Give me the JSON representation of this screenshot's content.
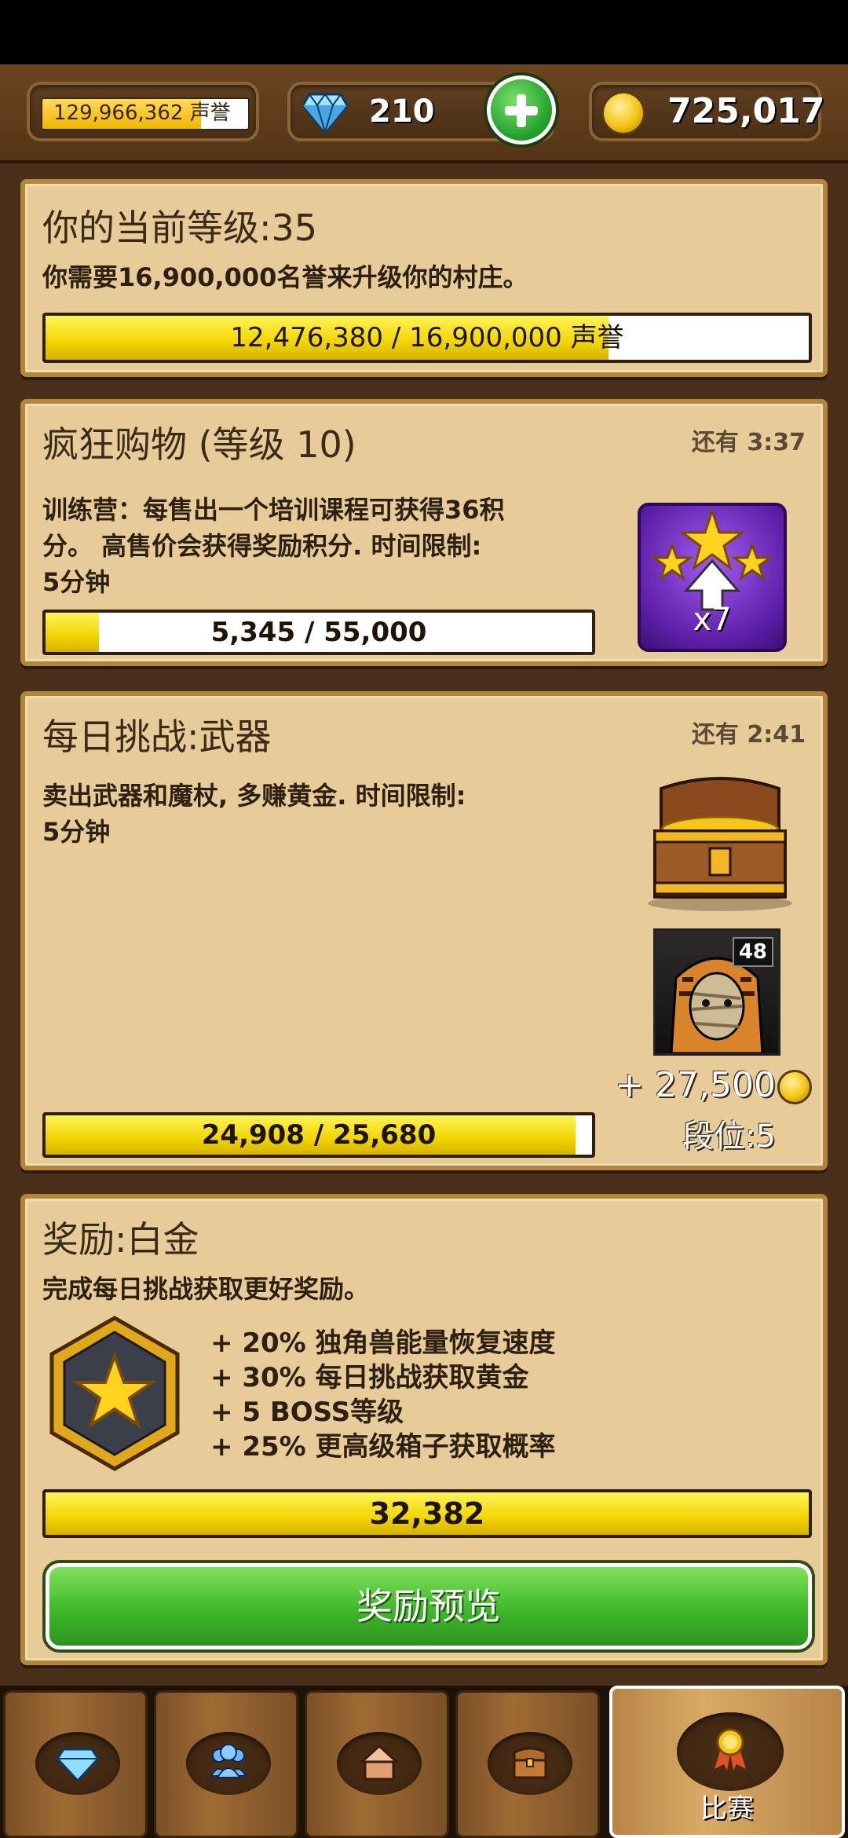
{
  "header": {
    "fame_value": "129,966,362",
    "fame_unit": "声誉",
    "fame_fill_fraction": 0.77,
    "gems": "210",
    "gold": "725,017"
  },
  "level_panel": {
    "title": "你的当前等级:35",
    "description": "你需要16,900,000名誉来升级你的村庄。",
    "progress_text": "12,476,380 / 16,900,000 声誉",
    "progress_fraction": 0.738
  },
  "frenzy_panel": {
    "title": "疯狂购物 (等级 10)",
    "timer": "还有 3:37",
    "description_lines": [
      "训练营：每售出一个培训课程可获得36积",
      "分。 高售价会获得奖励积分. 时间限制:",
      "5分钟"
    ],
    "progress_text": "5,345 / 55,000",
    "progress_fraction": 0.097,
    "boost_multiplier": "x7"
  },
  "daily_panel": {
    "title": "每日挑战:武器",
    "timer": "还有 2:41",
    "description_lines": [
      "卖出武器和魔杖, 多赚黄金. 时间限制:",
      "5分钟"
    ],
    "progress_text": "24,908 / 25,680",
    "progress_fraction": 0.97,
    "boss_level": "48",
    "reward": "+ 27,500",
    "rank": "段位:5"
  },
  "rewards_panel": {
    "title": "奖励:白金",
    "subtitle": "完成每日挑战获取更好奖励。",
    "bonuses": [
      "+ 20% 独角兽能量恢复速度",
      "+ 30% 每日挑战获取黄金",
      "+ 5 BOSS等级",
      "+ 25% 更高级箱子获取概率"
    ],
    "points": "32,382",
    "preview_button": "奖励预览"
  },
  "nav": {
    "tabs": [
      "gem-icon",
      "people-icon",
      "house-icon",
      "chest-icon",
      "medal-icon"
    ],
    "active_label": "比赛"
  }
}
